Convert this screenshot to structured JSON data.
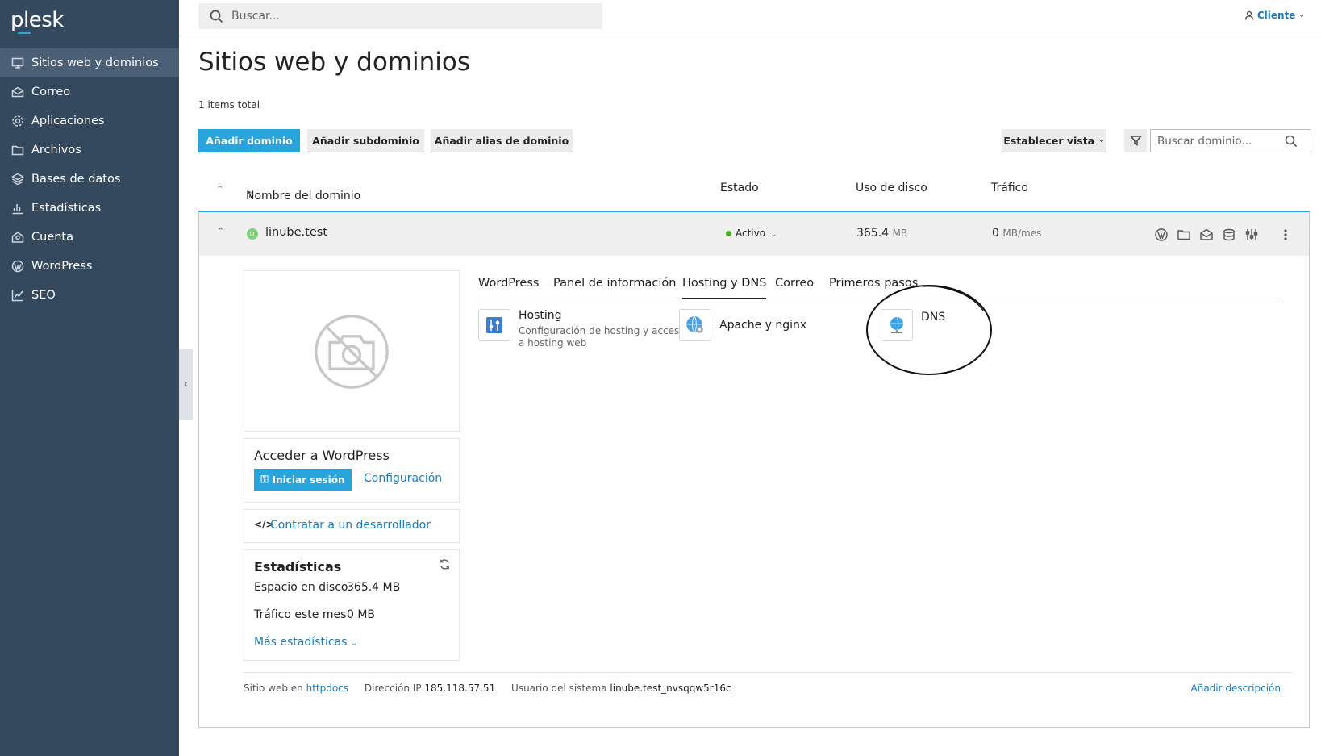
{
  "brand": {
    "name": "plesk",
    "accent": "#28a5dd",
    "sidebar_bg": "#34495e"
  },
  "sidebar": {
    "items": [
      {
        "label": "Sitios web y dominios",
        "icon": "monitor-icon",
        "active": true
      },
      {
        "label": "Correo",
        "icon": "mail-icon"
      },
      {
        "label": "Aplicaciones",
        "icon": "gear-icon"
      },
      {
        "label": "Archivos",
        "icon": "folder-icon"
      },
      {
        "label": "Bases de datos",
        "icon": "database-icon"
      },
      {
        "label": "Estadísticas",
        "icon": "bar-chart-icon"
      },
      {
        "label": "Cuenta",
        "icon": "account-icon"
      },
      {
        "label": "WordPress",
        "icon": "wordpress-icon"
      },
      {
        "label": "SEO",
        "icon": "seo-chart-icon"
      }
    ]
  },
  "topbar": {
    "search_placeholder": "Buscar...",
    "user_label": "Cliente"
  },
  "page": {
    "title": "Sitios web y dominios",
    "items_total": "1 items total"
  },
  "toolbar": {
    "add_domain": "Añadir dominio",
    "add_subdomain": "Añadir subdominio",
    "add_alias": "Añadir alias de dominio",
    "set_view": "Establecer vista",
    "domain_search_placeholder": "Buscar dominio..."
  },
  "table": {
    "headers": {
      "name": "Nombre del dominio",
      "status": "Estado",
      "disk": "Uso de disco",
      "traffic": "Tráfico"
    },
    "row": {
      "domain": "linube.test",
      "avatar": "LT",
      "status": "Activo",
      "disk_value": "365.4",
      "disk_unit": "MB",
      "traffic_value": "0",
      "traffic_unit": "MB/mes"
    }
  },
  "wordpress_card": {
    "title": "Acceder a WordPress",
    "login": "Iniciar sesión",
    "config": "Configuración"
  },
  "developer_link": "Contratar a un desarrollador",
  "stats": {
    "title": "Estadísticas",
    "disk_label": "Espacio en disco",
    "disk_value": "365.4 MB",
    "traffic_label": "Tráfico este mes",
    "traffic_value": "0 MB",
    "more": "Más estadísticas"
  },
  "tabs": [
    "WordPress",
    "Panel de información",
    "Hosting y DNS",
    "Correo",
    "Primeros pasos"
  ],
  "active_tab": "Hosting y DNS",
  "tools": {
    "hosting": {
      "title": "Hosting",
      "desc1": "Configuración de hosting y acceso",
      "desc2": "a hosting web"
    },
    "apache": {
      "title": "Apache y nginx"
    },
    "dns": {
      "title": "DNS"
    }
  },
  "footer": {
    "site_label": "Sitio web en",
    "site_value": "httpdocs",
    "ip_label": "Dirección IP",
    "ip_value": "185.118.57.51",
    "user_label": "Usuario del sistema",
    "user_value": "linube.test_nvsqqw5r16c",
    "add_desc": "Añadir descripción"
  }
}
